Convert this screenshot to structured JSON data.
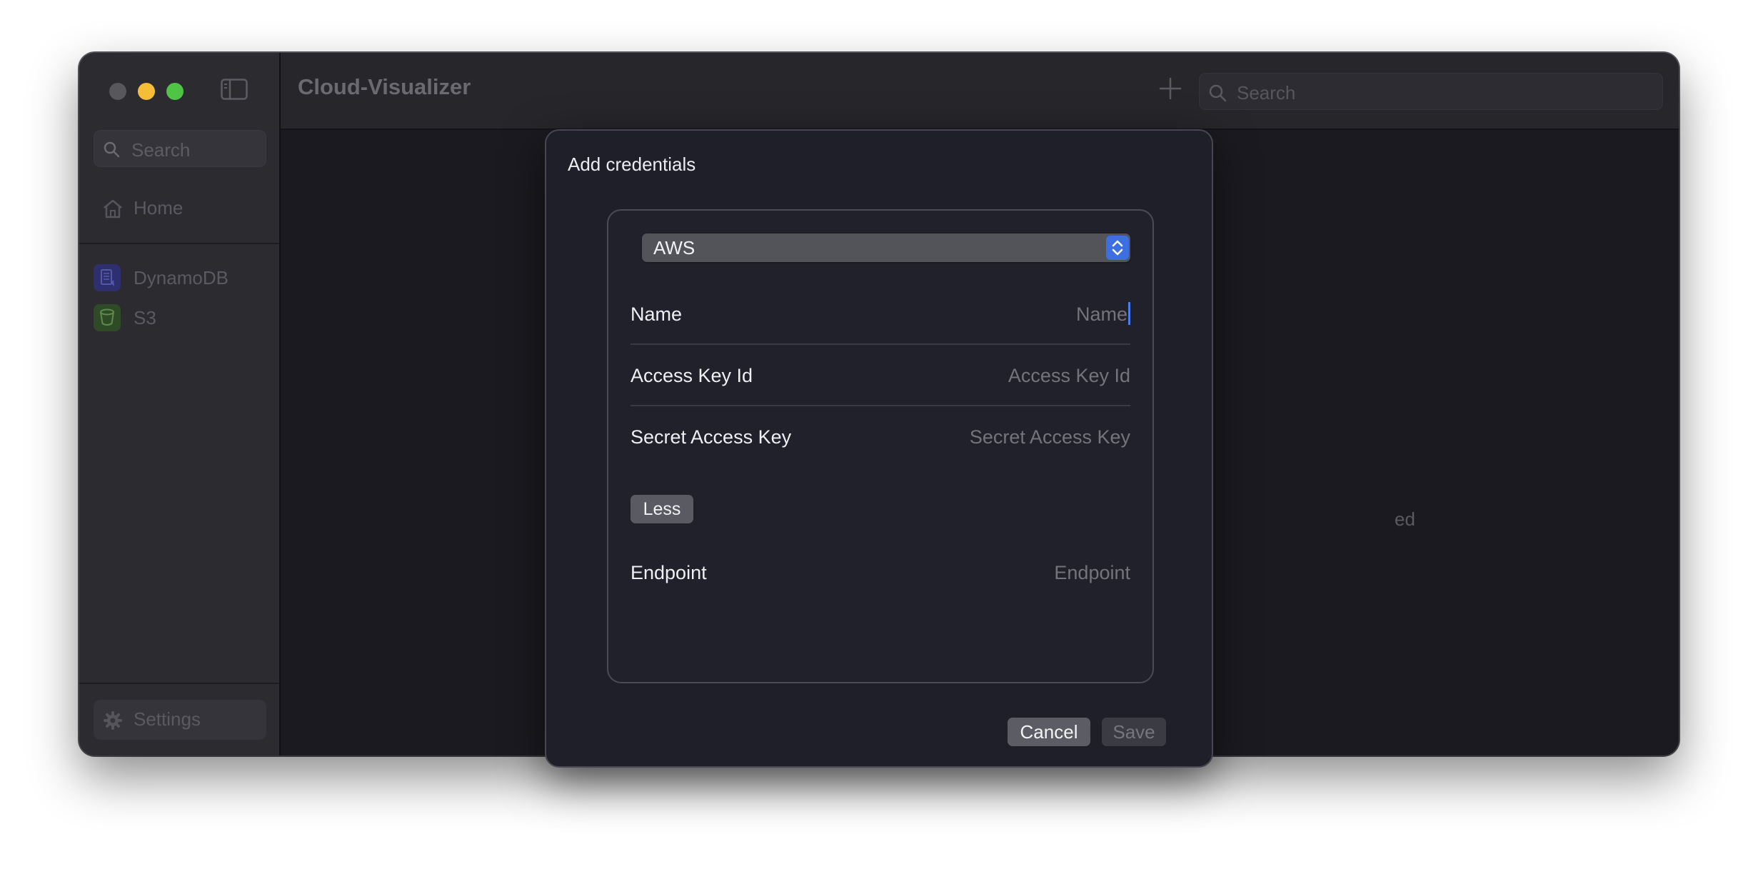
{
  "window": {
    "title": "Cloud-Visualizer"
  },
  "sidebar": {
    "search_placeholder": "Search",
    "home_label": "Home",
    "services": [
      {
        "label": "DynamoDB",
        "icon": "dynamodb-icon",
        "color": "#2e2f6e"
      },
      {
        "label": "S3",
        "icon": "s3-bucket-icon",
        "color": "#2f4a26"
      }
    ],
    "settings_label": "Settings"
  },
  "toolbar": {
    "search_placeholder": "Search"
  },
  "background": {
    "partial_text": "ed"
  },
  "dialog": {
    "title": "Add credentials",
    "provider": "AWS",
    "fields": {
      "name": {
        "label": "Name",
        "placeholder": "Name"
      },
      "access_key_id": {
        "label": "Access Key Id",
        "placeholder": "Access Key Id"
      },
      "secret_access_key": {
        "label": "Secret Access Key",
        "placeholder": "Secret Access Key"
      },
      "endpoint": {
        "label": "Endpoint",
        "placeholder": "Endpoint"
      }
    },
    "less_label": "Less",
    "cancel_label": "Cancel",
    "save_label": "Save"
  },
  "colors": {
    "accent": "#3d6fe0",
    "close": "#58585c",
    "minimize": "#f5bd38",
    "maximize": "#4fc446"
  }
}
